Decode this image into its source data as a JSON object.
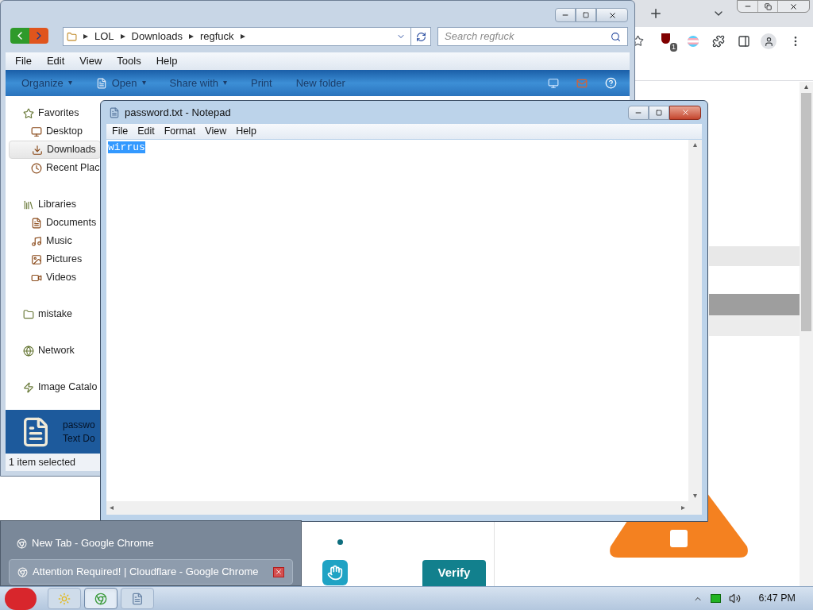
{
  "browser": {
    "extension_badge": "1",
    "page": {
      "verify_button": "Verify"
    }
  },
  "explorer": {
    "breadcrumb": [
      "LOL",
      "Downloads",
      "regfuck"
    ],
    "search": {
      "placeholder": "Search regfuck"
    },
    "menu": [
      "File",
      "Edit",
      "View",
      "Tools",
      "Help"
    ],
    "commands": [
      {
        "label": "Organize",
        "dropdown": true
      },
      {
        "label": "Open",
        "dropdown": true
      },
      {
        "label": "Share with",
        "dropdown": true
      },
      {
        "label": "Print",
        "dropdown": false
      },
      {
        "label": "New folder",
        "dropdown": false
      }
    ],
    "sidebar": [
      {
        "label": "Favorites",
        "selected": false,
        "children": [
          {
            "label": "Desktop",
            "selected": false
          },
          {
            "label": "Downloads",
            "selected": true
          },
          {
            "label": "Recent Plac",
            "selected": false
          }
        ]
      },
      {
        "label": "Libraries",
        "selected": false,
        "children": [
          {
            "label": "Documents",
            "selected": false
          },
          {
            "label": "Music",
            "selected": false
          },
          {
            "label": "Pictures",
            "selected": false
          },
          {
            "label": "Videos",
            "selected": false
          }
        ]
      },
      {
        "label": "mistake",
        "selected": false
      },
      {
        "label": "Network",
        "selected": false
      },
      {
        "label": "Image Catalo",
        "selected": false
      }
    ],
    "details": {
      "name": "passwo",
      "type": "Text Do"
    },
    "status_bar": "1 item selected"
  },
  "notepad": {
    "title": "password.txt - Notepad",
    "menu": [
      "File",
      "Edit",
      "Format",
      "View",
      "Help"
    ],
    "text": "wirrus",
    "text_selected": true
  },
  "taskbar": {
    "preview": [
      {
        "label": "New Tab - Google Chrome",
        "selected": false
      },
      {
        "label": "Attention Required! | Cloudflare - Google Chrome",
        "selected": true
      }
    ],
    "buttons": [
      {
        "kind": "sun",
        "selected": false
      },
      {
        "kind": "browser",
        "selected": true
      },
      {
        "kind": "notepad",
        "selected": false
      }
    ],
    "clock": "6:47 PM"
  }
}
